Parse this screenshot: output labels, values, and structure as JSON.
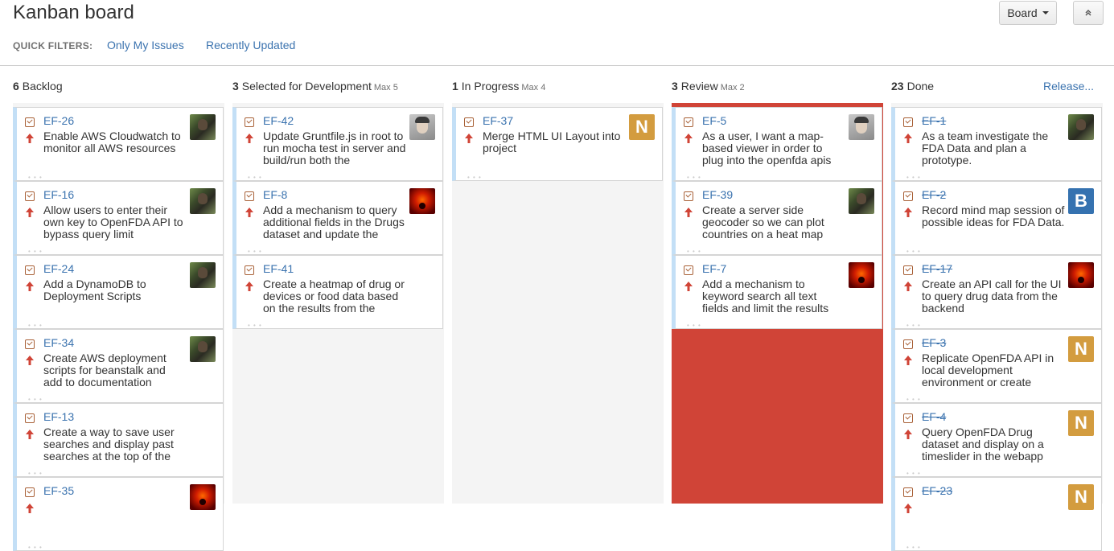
{
  "header": {
    "title": "Kanban board",
    "board_button": "Board",
    "quick_filters_label": "QUICK FILTERS:",
    "quick_filters": [
      "Only My Issues",
      "Recently Updated"
    ]
  },
  "colors": {
    "link": "#3b73af",
    "review_over_limit": "#d04437",
    "priority_arrow": "#d04437",
    "card_accent": "#c3dff6",
    "avatar_n": "#d39c3f",
    "avatar_b": "#3572b0"
  },
  "columns": [
    {
      "count": "6",
      "name": "Backlog",
      "max": "",
      "cards": [
        {
          "key": "EF-26",
          "summary": "Enable AWS Cloudwatch to monitor all AWS resources",
          "avatar": "soldier",
          "done": false
        },
        {
          "key": "EF-16",
          "summary": "Allow users to enter their own key to OpenFDA API to bypass query limit",
          "avatar": "soldier",
          "done": false
        },
        {
          "key": "EF-24",
          "summary": "Add a DynamoDB to Deployment Scripts",
          "avatar": "soldier",
          "done": false
        },
        {
          "key": "EF-34",
          "summary": "Create AWS deployment scripts for beanstalk and add to documentation",
          "avatar": "soldier",
          "done": false
        },
        {
          "key": "EF-13",
          "summary": "Create a way to save user searches and display past searches at the top of the",
          "avatar": "",
          "done": false
        },
        {
          "key": "EF-35",
          "summary": "",
          "avatar": "red",
          "done": false
        }
      ]
    },
    {
      "count": "3",
      "name": "Selected for Development",
      "max": "Max 5",
      "cards": [
        {
          "key": "EF-42",
          "summary": "Update Gruntfile.js in root to run mocha test in server and build/run both the",
          "avatar": "man",
          "done": false
        },
        {
          "key": "EF-8",
          "summary": "Add a mechanism to query additional fields in the Drugs dataset and update the",
          "avatar": "red",
          "done": false
        },
        {
          "key": "EF-41",
          "summary": "Create a heatmap of drug or devices or food data based on the results from the",
          "avatar": "",
          "done": false
        }
      ]
    },
    {
      "count": "1",
      "name": "In Progress",
      "max": "Max 4",
      "cards": [
        {
          "key": "EF-37",
          "summary": "Merge HTML UI Layout into project",
          "avatar": "N",
          "done": false
        }
      ]
    },
    {
      "count": "3",
      "name": "Review",
      "max": "Max 2",
      "cards": [
        {
          "key": "EF-5",
          "summary": "As a user, I want a map-based viewer in order to plug into the openfda apis",
          "avatar": "man",
          "done": false
        },
        {
          "key": "EF-39",
          "summary": "Create a server side geocoder so we can plot countries on a heat map",
          "avatar": "soldier",
          "done": false
        },
        {
          "key": "EF-7",
          "summary": "Add a mechanism to keyword search all text fields and limit the results",
          "avatar": "red",
          "done": false
        }
      ]
    },
    {
      "count": "23",
      "name": "Done",
      "max": "",
      "release": "Release...",
      "cards": [
        {
          "key": "EF-1",
          "summary": "As a team investigate the FDA Data and plan a prototype.",
          "avatar": "soldier",
          "done": true
        },
        {
          "key": "EF-2",
          "summary": "Record mind map session of possible ideas for FDA Data.",
          "avatar": "B",
          "done": true
        },
        {
          "key": "EF-17",
          "summary": "Create an API call for the UI to query drug data from the backend",
          "avatar": "red",
          "done": true
        },
        {
          "key": "EF-3",
          "summary": "Replicate OpenFDA API in local development environment or create",
          "avatar": "N",
          "done": true
        },
        {
          "key": "EF-4",
          "summary": "Query OpenFDA Drug dataset and display on a timeslider in the webapp",
          "avatar": "N",
          "done": true
        },
        {
          "key": "EF-23",
          "summary": "",
          "avatar": "N",
          "done": true
        }
      ]
    }
  ]
}
